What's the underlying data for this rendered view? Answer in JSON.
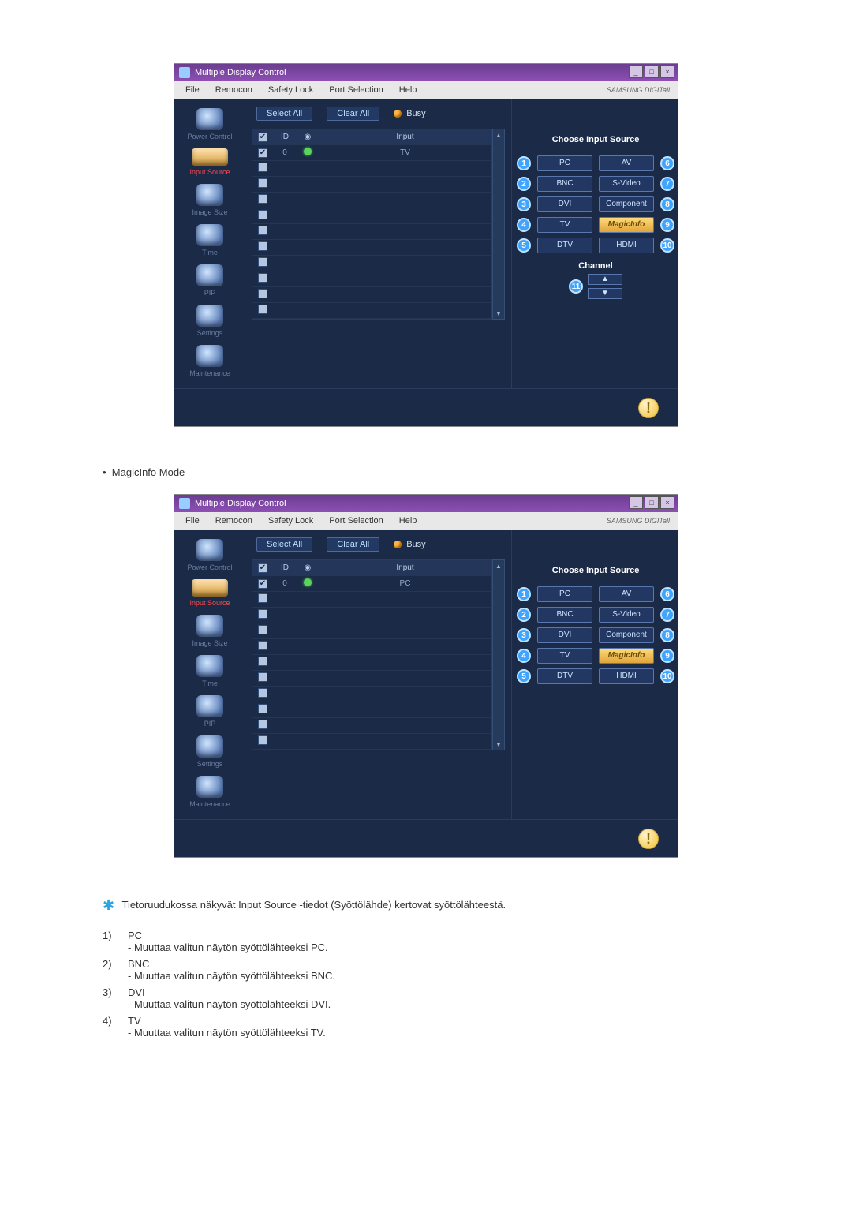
{
  "app": {
    "title": "Multiple Display Control",
    "brand": "SAMSUNG DIGITall"
  },
  "menu": {
    "file": "File",
    "remocon": "Remocon",
    "safety": "Safety Lock",
    "port": "Port Selection",
    "help": "Help"
  },
  "sidebar": {
    "items": [
      {
        "label": "Power Control"
      },
      {
        "label": "Input Source"
      },
      {
        "label": "Image Size"
      },
      {
        "label": "Time"
      },
      {
        "label": "PIP"
      },
      {
        "label": "Settings"
      },
      {
        "label": "Maintenance"
      }
    ]
  },
  "toolbar": {
    "select_all": "Select All",
    "clear_all": "Clear All",
    "busy": "Busy"
  },
  "table": {
    "headers": {
      "id": "ID",
      "input": "Input"
    },
    "tv_value": "TV",
    "pc_value": "PC",
    "id_first": "0"
  },
  "right": {
    "title": "Choose Input Source",
    "sources_left": [
      "PC",
      "BNC",
      "DVI",
      "TV",
      "DTV"
    ],
    "sources_right": [
      "AV",
      "S-Video",
      "Component",
      "MagicInfo",
      "HDMI"
    ],
    "nums_left": [
      "1",
      "2",
      "3",
      "4",
      "5"
    ],
    "nums_right": [
      "6",
      "7",
      "8",
      "9",
      "10"
    ],
    "channel": {
      "title": "Channel",
      "num": "11",
      "up": "▲",
      "down": "▼"
    }
  },
  "caption": {
    "mode": "MagicInfo Mode"
  },
  "note": "Tietoruudukossa näkyvät Input Source -tiedot (Syöttölähde) kertovat syöttölähteestä.",
  "list": [
    {
      "n": "1)",
      "t": "PC",
      "d": "- Muuttaa valitun näytön syöttölähteeksi PC."
    },
    {
      "n": "2)",
      "t": "BNC",
      "d": "- Muuttaa valitun näytön syöttölähteeksi BNC."
    },
    {
      "n": "3)",
      "t": "DVI",
      "d": "- Muuttaa valitun näytön syöttölähteeksi DVI."
    },
    {
      "n": "4)",
      "t": "TV",
      "d": "- Muuttaa valitun näytön syöttölähteeksi TV."
    }
  ]
}
